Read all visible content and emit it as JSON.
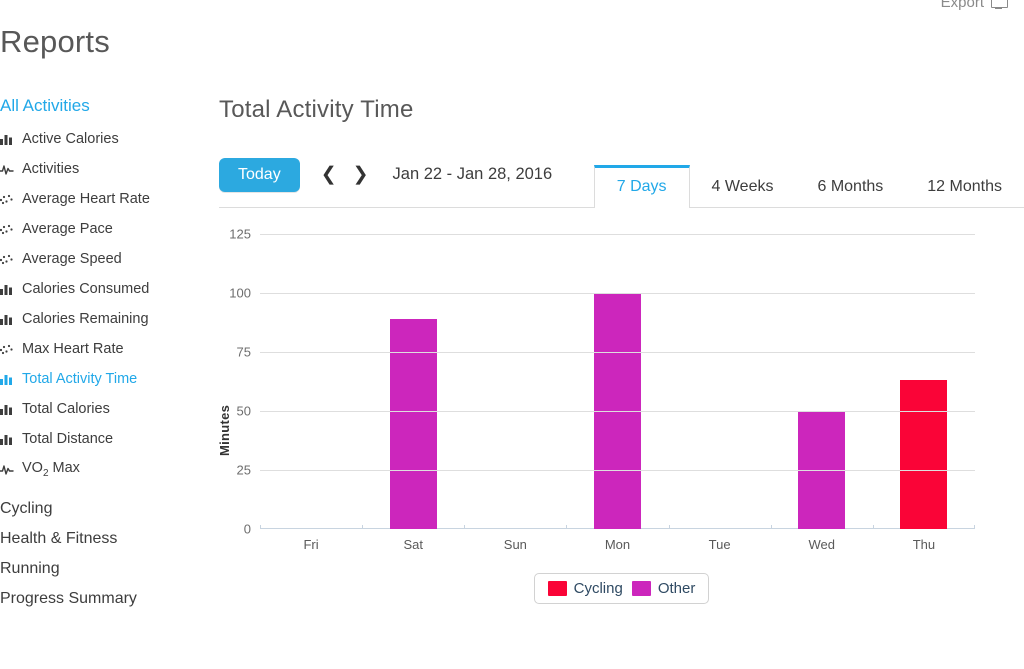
{
  "export": {
    "label": "Export",
    "icon": "export-screen-icon"
  },
  "page_title": "Reports",
  "sidebar": {
    "header": "All Activities",
    "items": [
      {
        "label": "Active Calories",
        "icon": "bar-chart-icon",
        "active": false
      },
      {
        "label": "Activities",
        "icon": "pulse-line-icon",
        "active": false
      },
      {
        "label": "Average Heart Rate",
        "icon": "scatter-plot-icon",
        "active": false
      },
      {
        "label": "Average Pace",
        "icon": "scatter-plot-icon",
        "active": false
      },
      {
        "label": "Average Speed",
        "icon": "scatter-plot-icon",
        "active": false
      },
      {
        "label": "Calories Consumed",
        "icon": "bar-chart-icon",
        "active": false
      },
      {
        "label": "Calories Remaining",
        "icon": "bar-chart-icon",
        "active": false
      },
      {
        "label": "Max Heart Rate",
        "icon": "scatter-plot-icon",
        "active": false
      },
      {
        "label": "Total Activity Time",
        "icon": "bar-chart-icon",
        "active": true
      },
      {
        "label": "Total Calories",
        "icon": "bar-chart-icon",
        "active": false
      },
      {
        "label": "Total Distance",
        "icon": "bar-chart-icon",
        "active": false
      },
      {
        "label": "VO2 Max",
        "icon": "pulse-line-icon",
        "active": false,
        "html": "VO<sub>2</sub> Max"
      }
    ],
    "sections": [
      {
        "label": "Cycling"
      },
      {
        "label": "Health & Fitness"
      },
      {
        "label": "Running"
      },
      {
        "label": "Progress Summary"
      }
    ]
  },
  "main": {
    "title": "Total Activity Time",
    "toolbar": {
      "today_label": "Today",
      "prev_icon": "chevron-left-icon",
      "next_icon": "chevron-right-icon",
      "date_range": "Jan 22 - Jan 28, 2016",
      "tabs": [
        {
          "label": "7 Days",
          "active": true
        },
        {
          "label": "4 Weeks",
          "active": false
        },
        {
          "label": "6 Months",
          "active": false
        },
        {
          "label": "12 Months",
          "active": false
        }
      ]
    }
  },
  "colors": {
    "accent": "#21a8e8",
    "today_button": "#2ca9e0",
    "cycling": "#fa0437",
    "other": "#cc26bc",
    "gridline": "#dedede",
    "axis": "#c8d4e0"
  },
  "chart_data": {
    "type": "bar",
    "title": "Total Activity Time",
    "xlabel": "",
    "ylabel": "Minutes",
    "categories": [
      "Fri",
      "Sat",
      "Sun",
      "Mon",
      "Tue",
      "Wed",
      "Thu"
    ],
    "ylim": [
      0,
      125
    ],
    "yticks": [
      0,
      25,
      50,
      75,
      100,
      125
    ],
    "grid": true,
    "legend_position": "bottom",
    "legend": [
      {
        "name": "Cycling",
        "color": "#fa0437"
      },
      {
        "name": "Other",
        "color": "#cc26bc"
      }
    ],
    "values": [
      0,
      89,
      0,
      100,
      0,
      50,
      63
    ],
    "bar_colors": [
      "#cc26bc",
      "#cc26bc",
      "#cc26bc",
      "#cc26bc",
      "#cc26bc",
      "#cc26bc",
      "#fa0437"
    ],
    "bar_series": [
      "Other",
      "Other",
      "Other",
      "Other",
      "Other",
      "Other",
      "Cycling"
    ],
    "series": [
      {
        "name": "Other",
        "values": [
          0,
          89,
          0,
          100,
          0,
          50,
          0
        ]
      },
      {
        "name": "Cycling",
        "values": [
          0,
          0,
          0,
          0,
          0,
          0,
          63
        ]
      }
    ]
  }
}
